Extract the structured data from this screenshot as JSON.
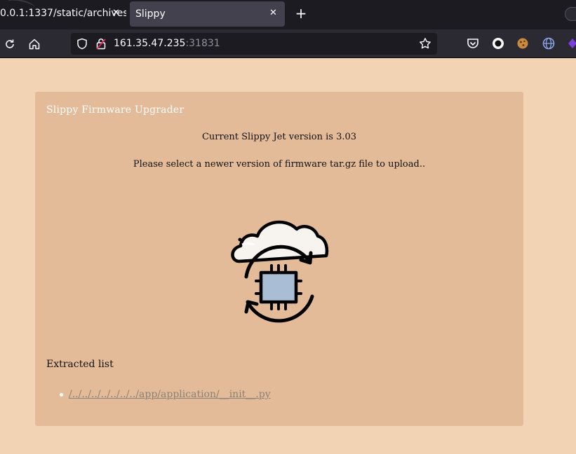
{
  "browser": {
    "tabs": [
      {
        "title": "0.0.1:1337/static/archives",
        "close": "✕"
      },
      {
        "title": "Slippy",
        "close": "✕"
      }
    ],
    "new_tab": "+",
    "url": {
      "host": "161.35.47.235",
      "port": ":31831"
    }
  },
  "page": {
    "title": "Slippy Firmware Upgrader",
    "version_text": "Current Slippy Jet version is 3.03",
    "instruction_text": "Please select a newer version of firmware tar.gz file to upload..",
    "extracted_heading": "Extracted list",
    "extracted_items": [
      "/../../../../../../../app/application/__init__.py"
    ]
  },
  "colors": {
    "page_bg": "#f2d4b5",
    "card_bg": "#e4bb98",
    "chip_fill": "#a9bdd4",
    "link": "#8a8277"
  },
  "icons": [
    "reload-icon",
    "home-icon",
    "shield-icon",
    "lock-icon",
    "star-icon",
    "pocket-icon",
    "firmware-upload-icon"
  ]
}
